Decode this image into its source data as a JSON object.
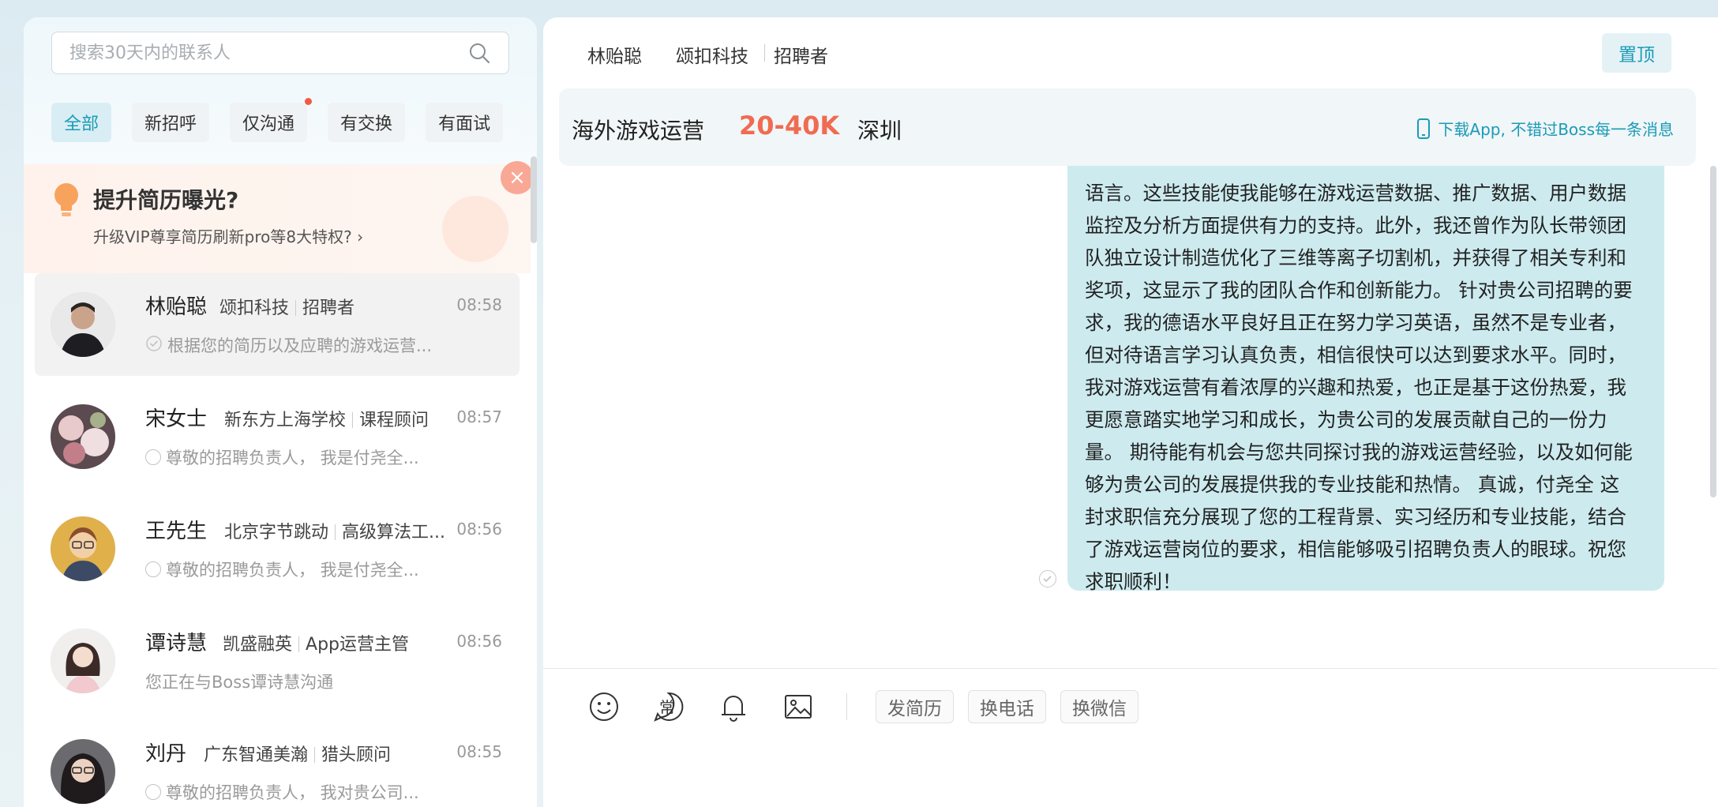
{
  "search": {
    "placeholder": "搜索30天内的联系人"
  },
  "filters": [
    {
      "label": "全部",
      "active": true
    },
    {
      "label": "新招呼",
      "active": false
    },
    {
      "label": "仅沟通",
      "active": false,
      "has_dot": true
    },
    {
      "label": "有交换",
      "active": false
    },
    {
      "label": "有面试",
      "active": false
    }
  ],
  "promo": {
    "title": "提升简历曝光?",
    "subtitle": "升级VIP尊享简历刷新pro等8大特权?",
    "arrow": "›",
    "close": "×"
  },
  "contacts": [
    {
      "name": "林贻聪",
      "company": "颂扣科技",
      "role": "招聘者",
      "time": "08:58",
      "message": "根据您的简历以及应聘的游戏运营...",
      "status": "read"
    },
    {
      "name": "宋女士",
      "company": "新东方上海学校",
      "role": "课程顾问",
      "time": "08:57",
      "message": "尊敬的招聘负责人， 我是付尧全...",
      "status": "sent"
    },
    {
      "name": "王先生",
      "company": "北京字节跳动",
      "role": "高级算法工...",
      "time": "08:56",
      "message": "尊敬的招聘负责人， 我是付尧全...",
      "status": "sent"
    },
    {
      "name": "谭诗慧",
      "company": "凯盛融英",
      "role": "App运营主管",
      "time": "08:56",
      "message": "您正在与Boss谭诗慧沟通",
      "status": "none"
    },
    {
      "name": "刘丹",
      "company": "广东智通美瀚",
      "role": "猎头顾问",
      "time": "08:55",
      "message": "尊敬的招聘负责人， 我对贵公司...",
      "status": "sent"
    }
  ],
  "chat_header": {
    "name": "林贻聪",
    "company": "颂扣科技",
    "role": "招聘者",
    "pin_label": "置顶"
  },
  "job": {
    "title": "海外游戏运营",
    "salary": "20-40K",
    "city": "深圳",
    "app_tip": "下载App, 不错过Boss每一条消息"
  },
  "message_lines": [
    "语言。这些技能使我能够在游戏运营数据、推广数据、用户数据",
    "监控及分析方面提供有力的支持。此外，我还曾作为队长带领团",
    "队独立设计制造优化了三维等离子切割机，并获得了相关专利和",
    "奖项，这显示了我的团队合作和创新能力。 针对贵公司招聘的要",
    "求，我的德语水平良好且正在努力学习英语，虽然不是专业者，",
    "但对待语言学习认真负责，相信很快可以达到要求水平。同时，",
    "我对游戏运营有着浓厚的兴趣和热爱，也正是基于这份热爱，我",
    "更愿意踏实地学习和成长，为贵公司的发展贡献自己的一份力",
    "量。 期待能有机会与您共同探讨我的游戏运营经验，以及如何能",
    "够为贵公司的发展提供我的专业技能和热情。 真诚，付尧全 这",
    "封求职信充分展现了您的工程背景、实习经历和专业技能，结合",
    "了游戏运营岗位的要求，相信能够吸引招聘负责人的眼球。祝您",
    "求职顺利！"
  ],
  "toolbar": {
    "common_label": "常",
    "buttons": [
      "发简历",
      "换电话",
      "换微信"
    ]
  },
  "colors": {
    "accent": "#1b9bb6",
    "salary": "#f06b52",
    "bubble": "#cdebef"
  }
}
